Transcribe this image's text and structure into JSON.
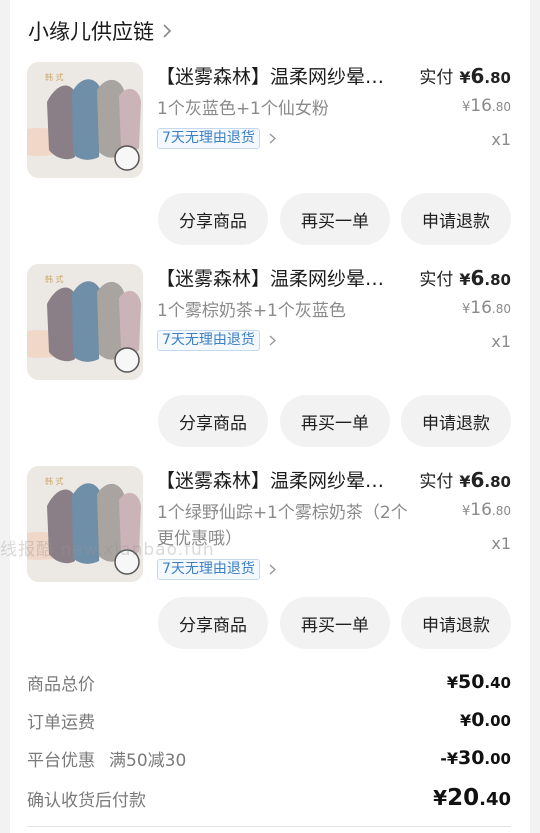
{
  "shop": {
    "name": "小缘儿供应链",
    "chevron_icon": "chevron-right-icon"
  },
  "items": [
    {
      "title": "【迷雾森林】温柔网纱晕染发箍",
      "spec": "1个灰蓝色+1个仙女粉",
      "tag": "7天无理由退货",
      "paid_label": "实付",
      "paid_cur": "¥",
      "paid_int": "6",
      "paid_dec": ".80",
      "orig_cur": "¥",
      "orig_int": "16",
      "orig_dec": ".80",
      "qty": "x1",
      "buttons": {
        "share": "分享商品",
        "rebuy": "再买一单",
        "refund": "申请退款"
      }
    },
    {
      "title": "【迷雾森林】温柔网纱晕染发箍",
      "spec": "1个雾棕奶茶+1个灰蓝色",
      "tag": "7天无理由退货",
      "paid_label": "实付",
      "paid_cur": "¥",
      "paid_int": "6",
      "paid_dec": ".80",
      "orig_cur": "¥",
      "orig_int": "16",
      "orig_dec": ".80",
      "qty": "x1",
      "buttons": {
        "share": "分享商品",
        "rebuy": "再买一单",
        "refund": "申请退款"
      }
    },
    {
      "title": "【迷雾森林】温柔网纱晕染发箍",
      "spec": "1个绿野仙踪+1个雾棕奶茶（2个更优惠哦）",
      "tag": "7天无理由退货",
      "paid_label": "实付",
      "paid_cur": "¥",
      "paid_int": "6",
      "paid_dec": ".80",
      "orig_cur": "¥",
      "orig_int": "16",
      "orig_dec": ".80",
      "qty": "x1",
      "buttons": {
        "share": "分享商品",
        "rebuy": "再买一单",
        "refund": "申请退款"
      }
    }
  ],
  "watermark": "线报酷 new.xianbao.fun",
  "summary": {
    "total": {
      "label": "商品总价",
      "cur": "¥",
      "int": "50",
      "dec": ".40"
    },
    "shipping": {
      "label": "订单运费",
      "cur": "¥",
      "int": "0",
      "dec": ".00"
    },
    "discount": {
      "label": "平台优惠",
      "sub": "满50减30",
      "cur": "-¥",
      "int": "30",
      "dec": ".00"
    },
    "payable": {
      "label": "确认收货后付款",
      "cur": "¥",
      "int": "20",
      "dec": ".40"
    }
  },
  "colors": {
    "tag_blue": "#3c7fc4",
    "button_bg": "#f2f2f2",
    "muted": "#8a8a8a"
  }
}
